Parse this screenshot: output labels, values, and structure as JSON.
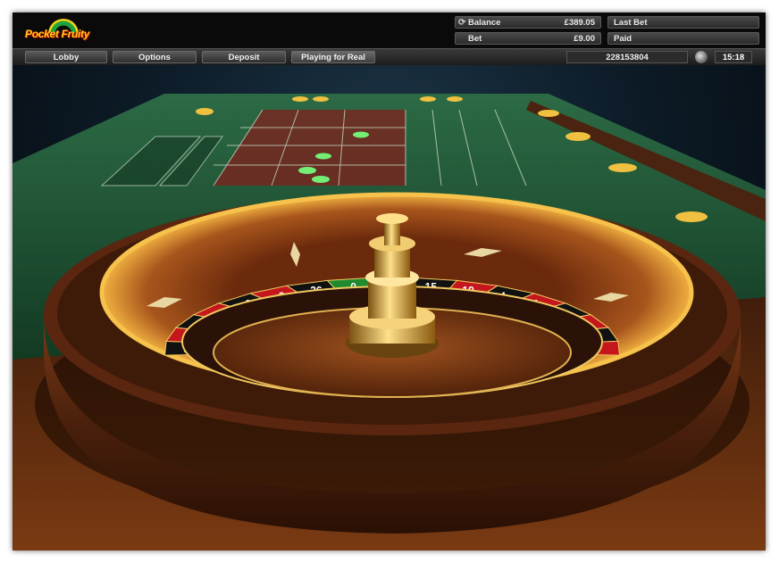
{
  "header": {
    "logo_text": "Pocket Fruity",
    "balance_label": "Balance",
    "balance_value": "£389.05",
    "last_bet_label": "Last Bet",
    "last_bet_value": "",
    "bet_label": "Bet",
    "bet_value": "£9.00",
    "paid_label": "Paid",
    "paid_value": ""
  },
  "nav": {
    "lobby": "Lobby",
    "options": "Options",
    "deposit": "Deposit",
    "mode": "Playing for Real",
    "session_id": "228153804",
    "clock": "15:18"
  },
  "wheel": {
    "pocket_numbers": [
      "29",
      "7",
      "28",
      "12",
      "35",
      "3",
      "26",
      "0",
      "32",
      "15",
      "19",
      "4",
      "21",
      "2",
      "25",
      "17",
      "34"
    ],
    "pocket_colors": [
      "#111111",
      "#c4161c",
      "#111111",
      "#c4161c",
      "#111111",
      "#c4161c",
      "#111111",
      "#1f8a2e",
      "#c4161c",
      "#111111",
      "#c4161c",
      "#111111",
      "#c4161c",
      "#111111",
      "#c4161c",
      "#111111",
      "#c4161c"
    ]
  },
  "colors": {
    "felt": "#1f5a36",
    "wood": "#5a2a10",
    "gold": "#d9a036",
    "red": "#c4161c",
    "black": "#111111"
  }
}
